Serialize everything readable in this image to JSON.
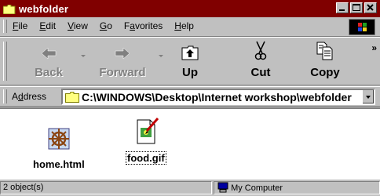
{
  "window": {
    "title": "webfolder",
    "title_bar_color": "#800000"
  },
  "title_buttons": [
    {
      "name": "minimize",
      "glyph": "_"
    },
    {
      "name": "maximize",
      "glyph": "□"
    },
    {
      "name": "close",
      "glyph": "×"
    }
  ],
  "menu": {
    "items": [
      {
        "pre": "",
        "key": "F",
        "post": "ile"
      },
      {
        "pre": "",
        "key": "E",
        "post": "dit"
      },
      {
        "pre": "",
        "key": "V",
        "post": "iew"
      },
      {
        "pre": "",
        "key": "G",
        "post": "o"
      },
      {
        "pre": "F",
        "key": "a",
        "post": "vorites"
      },
      {
        "pre": "",
        "key": "H",
        "post": "elp"
      }
    ]
  },
  "toolbar": {
    "back": "Back",
    "forward": "Forward",
    "up": "Up",
    "cut": "Cut",
    "copy": "Copy",
    "more": "»"
  },
  "address": {
    "label_pre": "A",
    "label_key": "d",
    "label_post": "dress",
    "value": "C:\\WINDOWS\\Desktop\\Internet workshop\\webfolder"
  },
  "files": [
    {
      "name": "home.html",
      "icon": "html-document-ship-wheel-icon"
    },
    {
      "name": "food.gif",
      "icon": "gif-image-icon"
    }
  ],
  "status": {
    "objects": "2 object(s)",
    "location": "My Computer"
  }
}
